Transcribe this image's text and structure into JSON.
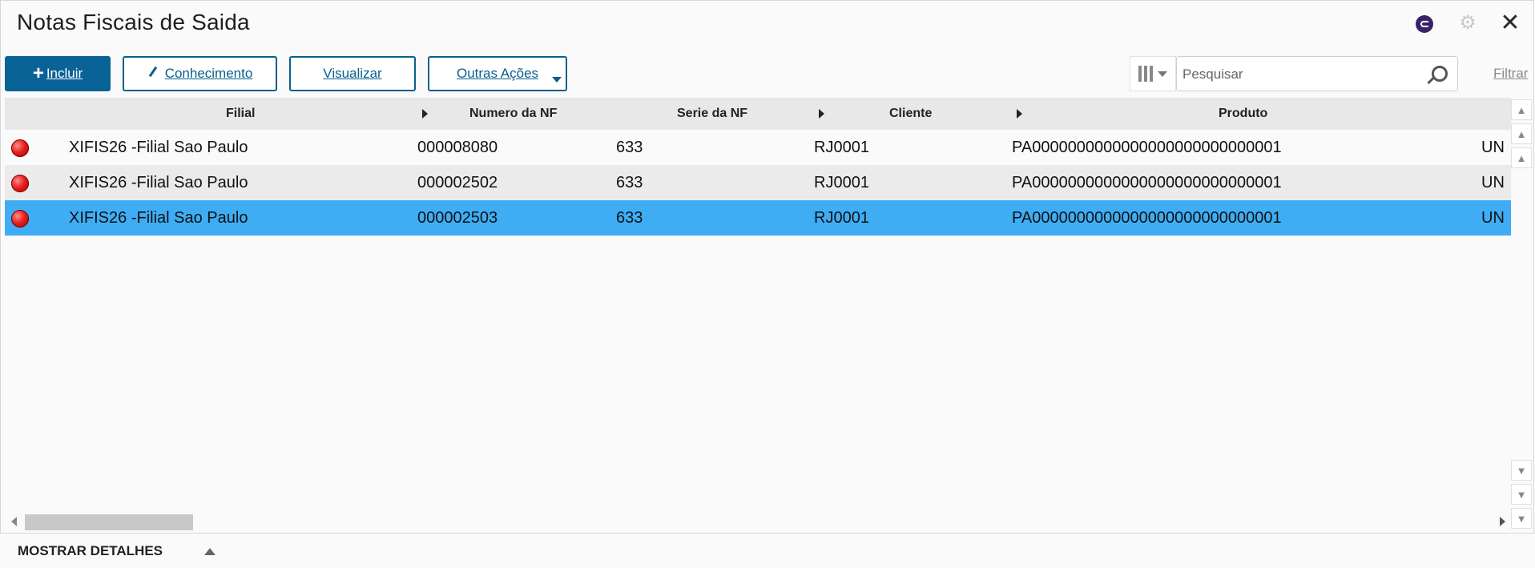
{
  "window": {
    "title": "Notas Fiscais de Saida",
    "icons": [
      "ci-icon",
      "gear-icon",
      "close-icon"
    ]
  },
  "toolbar": {
    "include_label": "Incluir",
    "conhecimento_label": "Conhecimento",
    "visualizar_label": "Visualizar",
    "outras_acoes_label": "Outras Ações",
    "search_placeholder": "Pesquisar",
    "filtrar_label": "Filtrar"
  },
  "grid": {
    "headers": [
      "Filial",
      "Numero da NF",
      "Serie da NF",
      "Cliente",
      "Produto"
    ],
    "rows": [
      {
        "filial": "XIFIS26 -Filial Sao Paulo",
        "numero": "000008080",
        "serie": "633",
        "cliente": "RJ0001",
        "produto": "PA0000000000000000000000000001",
        "unidade": "UN",
        "status": "red",
        "state": "normal"
      },
      {
        "filial": "XIFIS26 -Filial Sao Paulo",
        "numero": "000002502",
        "serie": "633",
        "cliente": "RJ0001",
        "produto": "PA0000000000000000000000000001",
        "unidade": "UN",
        "status": "red",
        "state": "alt"
      },
      {
        "filial": "XIFIS26 -Filial Sao Paulo",
        "numero": "000002503",
        "serie": "633",
        "cliente": "RJ0001",
        "produto": "PA0000000000000000000000000001",
        "unidade": "UN",
        "status": "red",
        "state": "selected"
      }
    ]
  },
  "footer": {
    "details_label": "MOSTRAR DETALHES"
  },
  "colors": {
    "primary": "#0a6396",
    "selected_row": "#3eadf4",
    "alt_row": "#ebebeb",
    "header_bg": "#e8e8e8",
    "status_red": "#e41e1e"
  }
}
